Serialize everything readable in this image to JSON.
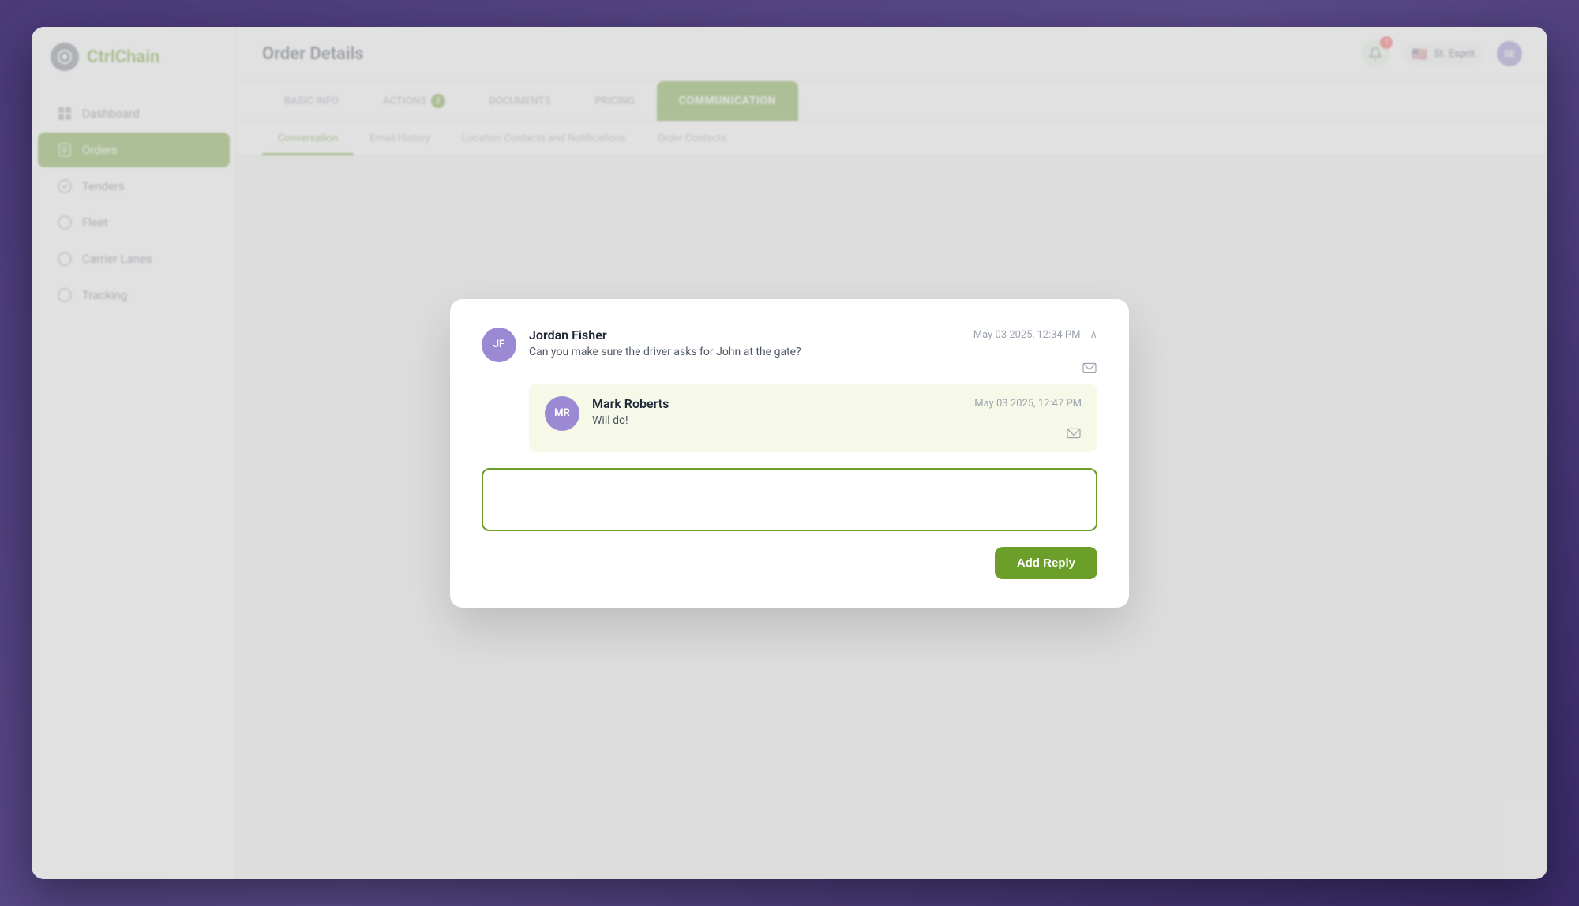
{
  "app": {
    "logo_text": "CtrlChain",
    "page_title": "Order Details"
  },
  "sidebar": {
    "items": [
      {
        "id": "dashboard",
        "label": "Dashboard",
        "active": false
      },
      {
        "id": "orders",
        "label": "Orders",
        "active": true
      },
      {
        "id": "tenders",
        "label": "Tenders",
        "active": false
      },
      {
        "id": "fleet",
        "label": "Fleet",
        "active": false
      },
      {
        "id": "carrier-lanes",
        "label": "Carrier Lanes",
        "active": false
      },
      {
        "id": "tracking",
        "label": "Tracking",
        "active": false
      }
    ]
  },
  "header": {
    "notification_count": "1",
    "user_name": "St. Esprit",
    "user_initials": "SE"
  },
  "main_tabs": [
    {
      "id": "basic-info",
      "label": "BASIC INFO",
      "badge": null,
      "active": false
    },
    {
      "id": "actions",
      "label": "ACTIONS",
      "badge": "2",
      "active": false
    },
    {
      "id": "documents",
      "label": "DOCUMENTS",
      "badge": null,
      "active": false
    },
    {
      "id": "pricing",
      "label": "PRICING",
      "badge": null,
      "active": false
    },
    {
      "id": "communication",
      "label": "COMMUNICATION",
      "badge": null,
      "active": true
    }
  ],
  "sub_tabs": [
    {
      "id": "conversation",
      "label": "Conversation",
      "active": true
    },
    {
      "id": "email-history",
      "label": "Email History",
      "active": false
    },
    {
      "id": "location-contacts",
      "label": "Location Contacts and Notifications",
      "active": false
    },
    {
      "id": "order-contacts",
      "label": "Order Contacts",
      "active": false
    }
  ],
  "conversation": {
    "message": {
      "author": "Jordan Fisher",
      "initials": "JF",
      "timestamp": "May 03 2025, 12:34 PM",
      "text": "Can you make sure the driver asks for John at the gate?"
    },
    "reply": {
      "author": "Mark Roberts",
      "initials": "MR",
      "timestamp": "May 03 2025, 12:47 PM",
      "text": "Will do!"
    },
    "textarea_placeholder": "",
    "add_reply_label": "Add Reply"
  }
}
